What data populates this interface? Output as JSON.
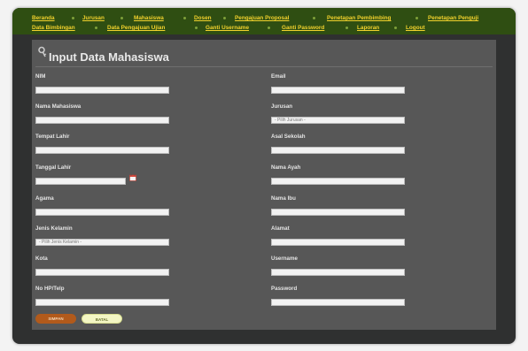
{
  "nav": {
    "row1": [
      "Beranda",
      "Jurusan",
      "Mahasiswa",
      "Dosen",
      "Pengajuan Proposal",
      "Penetapan Pembimbing",
      "Penetapan Penguji"
    ],
    "row2": [
      "Data Bimbingan",
      "Data Pengajuan Ujian",
      "Ganti Username",
      "Ganti Password",
      "Laporan",
      "Logout"
    ]
  },
  "page": {
    "title": "Input Data Mahasiswa"
  },
  "form": {
    "left": [
      {
        "label": "NIM",
        "value": ""
      },
      {
        "label": "Nama Mahasiswa",
        "value": ""
      },
      {
        "label": "Tempat Lahir",
        "value": ""
      },
      {
        "label": "Tanggal Lahir",
        "value": ""
      },
      {
        "label": "Agama",
        "value": ""
      },
      {
        "label": "Jenis Kelamin",
        "value": "- Pilih Jenis Kelamin -"
      },
      {
        "label": "Kota",
        "value": ""
      },
      {
        "label": "No HP/Telp",
        "value": ""
      }
    ],
    "right": [
      {
        "label": "Email",
        "value": ""
      },
      {
        "label": "Jurusan",
        "value": "- Pilih Jurusan -"
      },
      {
        "label": "Asal Sekolah",
        "value": ""
      },
      {
        "label": "Nama Ayah",
        "value": ""
      },
      {
        "label": "Nama Ibu",
        "value": ""
      },
      {
        "label": "Alamat",
        "value": ""
      },
      {
        "label": "Username",
        "value": ""
      },
      {
        "label": "Password",
        "value": ""
      }
    ],
    "save_label": "SIMPAN",
    "reset_label": "BATAL"
  },
  "colors": {
    "nav_bg": "#2f4e12",
    "nav_link": "#f2d22c",
    "panel_bg": "#575757",
    "save_button": "#b25a1b",
    "reset_button": "#f3f6c4"
  },
  "icons": {
    "title": "key-icon",
    "date": "calendar-icon"
  }
}
